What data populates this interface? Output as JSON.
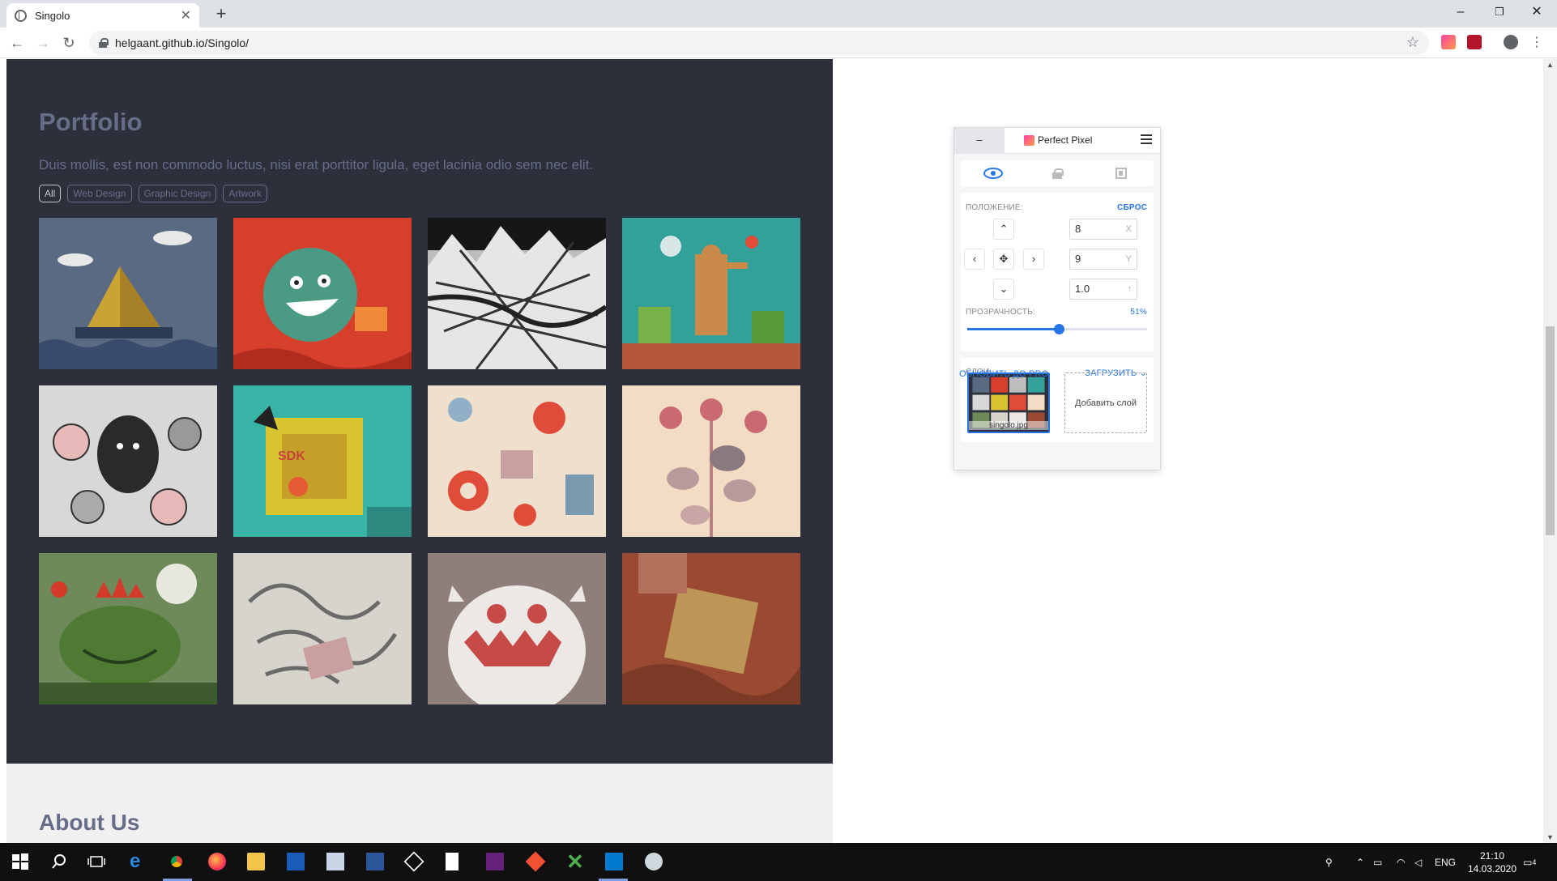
{
  "browser": {
    "tab_title": "Singolo",
    "tab_close": "✕",
    "new_tab": "+",
    "url": "helgaant.github.io/Singolo/",
    "window_controls": {
      "minimize": "–",
      "maximize": "❐",
      "close": "✕"
    },
    "nav": {
      "back": "←",
      "forward": "→",
      "reload": "↻"
    }
  },
  "page": {
    "portfolio": {
      "title": "Portfolio",
      "subtitle": "Duis mollis, est non commodo luctus, nisi erat porttitor ligula, eget lacinia odio sem nec elit.",
      "filters": [
        "All",
        "Web Design",
        "Graphic Design",
        "Artwork"
      ],
      "active_filter": "All"
    },
    "about": {
      "title": "About Us"
    }
  },
  "perfect_pixel": {
    "minimize_label": "–",
    "brand": "Perfect Pixel",
    "position_label": "ПОЛОЖЕНИЕ:",
    "reset_label": "СБРОС",
    "x_value": "8",
    "x_label": "X",
    "y_value": "9",
    "y_label": "Y",
    "scale_value": "1.0",
    "scale_label": "↑",
    "opacity_label": "ПРОЗРАЧНОСТЬ:",
    "opacity_value": "51%",
    "opacity_fraction": 0.51,
    "layers_label": "СЛОИ:",
    "upload_label": "ЗАГРУЗИТЬ",
    "layer_name": "singolo.jpg",
    "add_layer_label": "Добавить слой",
    "upgrade_label": "ОБНОВИТЬ ДО PRO",
    "arrows": {
      "up": "⌃",
      "down": "⌄",
      "left": "‹",
      "right": "›",
      "center": "✥"
    }
  },
  "taskbar": {
    "language": "ENG",
    "time": "21:10",
    "date": "14.03.2020",
    "notifications": "4"
  },
  "colors": {
    "portfolio_bg": "#2d303a",
    "accent_blue": "#2575e5",
    "text_muted": "#666d89"
  }
}
